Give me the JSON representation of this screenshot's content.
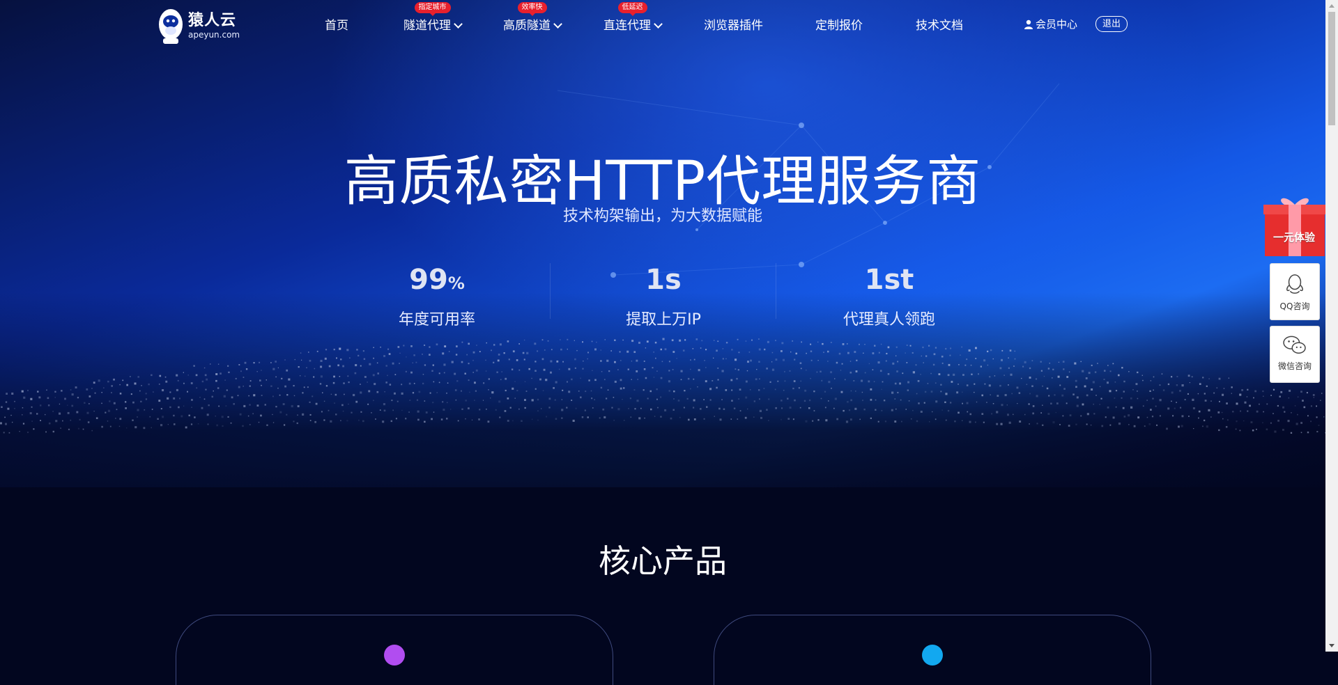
{
  "header": {
    "logo": {
      "name": "猿人云",
      "domain": "apeyun.com"
    },
    "nav": [
      {
        "label": "首页",
        "badge": null,
        "dropdown": false
      },
      {
        "label": "隧道代理",
        "badge": "指定城市",
        "dropdown": true
      },
      {
        "label": "高质隧道",
        "badge": "效率快",
        "dropdown": true
      },
      {
        "label": "直连代理",
        "badge": "低延迟",
        "dropdown": true
      },
      {
        "label": "浏览器插件",
        "badge": null,
        "dropdown": false
      },
      {
        "label": "定制报价",
        "badge": null,
        "dropdown": false
      },
      {
        "label": "技术文档",
        "badge": null,
        "dropdown": false
      }
    ],
    "member_center": "会员中心",
    "logout": "退出"
  },
  "hero": {
    "title": "高质私密HTTP代理服务商",
    "subtitle": "技术构架输出，为大数据赋能",
    "stats": [
      {
        "value": "99",
        "unit": "%",
        "label": "年度可用率"
      },
      {
        "value": "1s",
        "unit": "",
        "label": "提取上万IP"
      },
      {
        "value": "1st",
        "unit": "",
        "label": "代理真人领跑"
      }
    ]
  },
  "core_products": {
    "title": "核心产品",
    "cards": [
      {
        "accent": "#b14df0"
      },
      {
        "accent": "#12a8f0"
      }
    ]
  },
  "side_float": {
    "gift": "一元体验",
    "qq": "QQ咨询",
    "wechat": "微信咨询"
  },
  "colors": {
    "badge": "#e8202d",
    "hero_blue": "#1c6cf2",
    "background": "#02061f"
  }
}
